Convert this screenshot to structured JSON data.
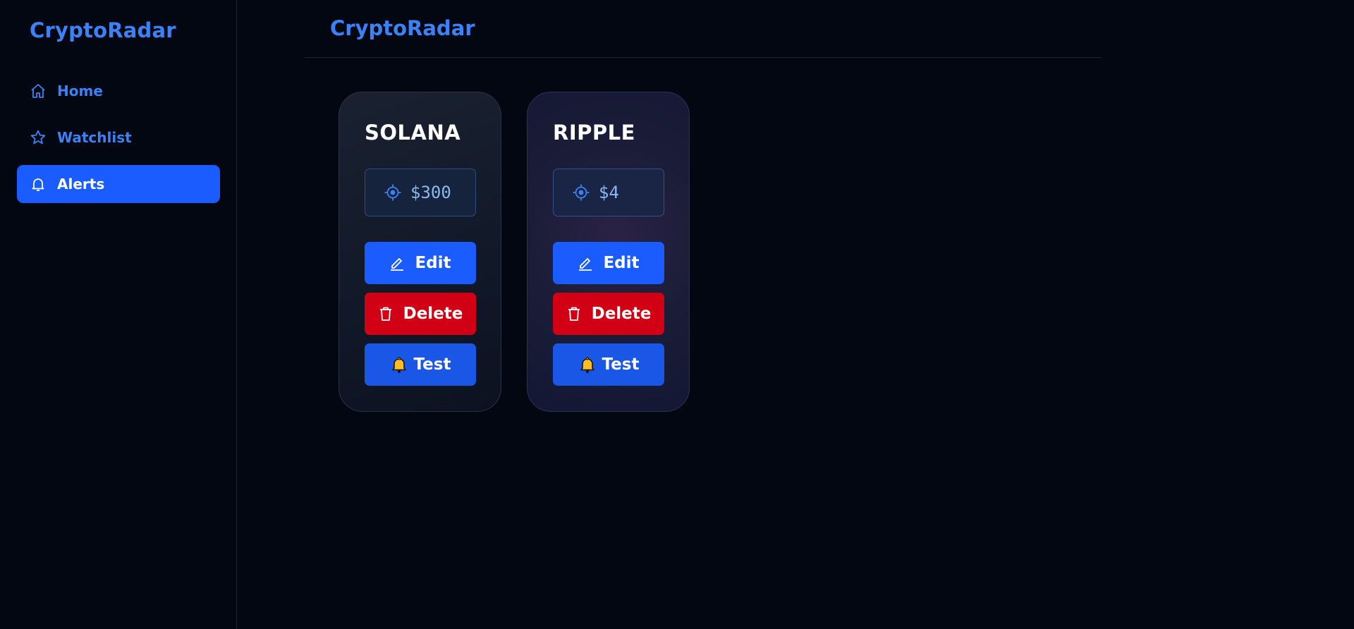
{
  "sidebar": {
    "brand": "CryptoRadar",
    "items": [
      {
        "label": "Home",
        "icon": "home-icon"
      },
      {
        "label": "Watchlist",
        "icon": "star-icon"
      },
      {
        "label": "Alerts",
        "icon": "bell-icon",
        "active": true
      }
    ]
  },
  "header": {
    "title": "CryptoRadar"
  },
  "alerts": [
    {
      "coin": "SOLANA",
      "target": "$300",
      "edit_label": "Edit",
      "delete_label": "Delete",
      "test_label": "Test"
    },
    {
      "coin": "RIPPLE",
      "target": "$4",
      "edit_label": "Edit",
      "delete_label": "Delete",
      "test_label": "Test"
    }
  ],
  "colors": {
    "accent": "#1a5cff",
    "brand_text": "#3b82f6",
    "danger": "#d10014",
    "background": "#030712"
  }
}
